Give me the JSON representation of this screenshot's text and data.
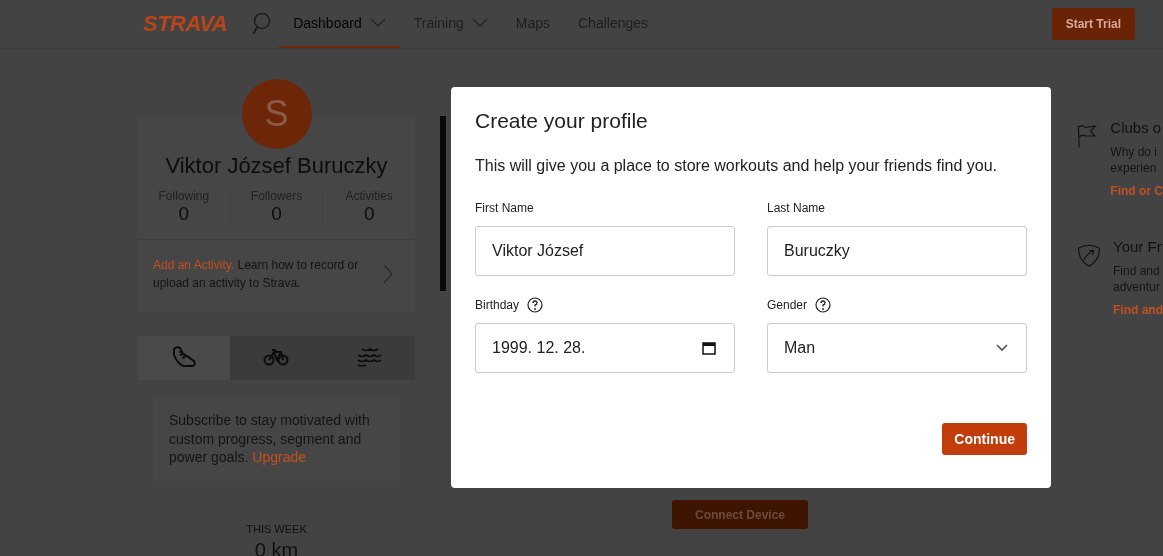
{
  "header": {
    "logo": "STRAVA",
    "nav": [
      {
        "label": "Dashboard",
        "dropdown": true,
        "selected": true
      },
      {
        "label": "Training",
        "dropdown": true,
        "selected": false
      },
      {
        "label": "Maps",
        "dropdown": false,
        "selected": false
      },
      {
        "label": "Challenges",
        "dropdown": false,
        "selected": false
      }
    ],
    "trial_button": "Start Trial"
  },
  "profile": {
    "initial": "S",
    "name": "Viktor József Buruczky",
    "stats": [
      {
        "label": "Following",
        "value": "0"
      },
      {
        "label": "Followers",
        "value": "0"
      },
      {
        "label": "Activities",
        "value": "0"
      }
    ],
    "add_activity_link": "Add an Activity.",
    "add_activity_text": "Learn how to record or upload an activity to Strava."
  },
  "sport_tabs": [
    {
      "kind": "run",
      "selected": true
    },
    {
      "kind": "ride",
      "selected": false
    },
    {
      "kind": "swim",
      "selected": false
    }
  ],
  "subscribe": {
    "text": "Subscribe to stay motivated with custom progress, segment and power goals.",
    "link": "Upgrade"
  },
  "this_week": {
    "label": "THIS WEEK",
    "value": "0 km"
  },
  "feed": {
    "connect_button": "Connect Device"
  },
  "right_cards": [
    {
      "kind": "flag",
      "title": "Clubs o",
      "lines": [
        "Why do i",
        "experien"
      ],
      "link": "Find or C"
    },
    {
      "kind": "shield",
      "title": "Your Fr",
      "lines": [
        "Find and",
        "adventur"
      ],
      "link": "Find and"
    }
  ],
  "modal": {
    "title": "Create your profile",
    "subtitle": "This will give you a place to store workouts and help your friends find you.",
    "fields": [
      {
        "kind": "text",
        "label": "First Name",
        "value": "Viktor József",
        "help": false
      },
      {
        "kind": "text",
        "label": "Last Name",
        "value": "Buruczky",
        "help": false
      },
      {
        "kind": "date",
        "label": "Birthday",
        "value": "1999. 12. 28.",
        "help": true
      },
      {
        "kind": "select",
        "label": "Gender",
        "value": "Man",
        "help": true
      }
    ],
    "continue_button": "Continue"
  }
}
